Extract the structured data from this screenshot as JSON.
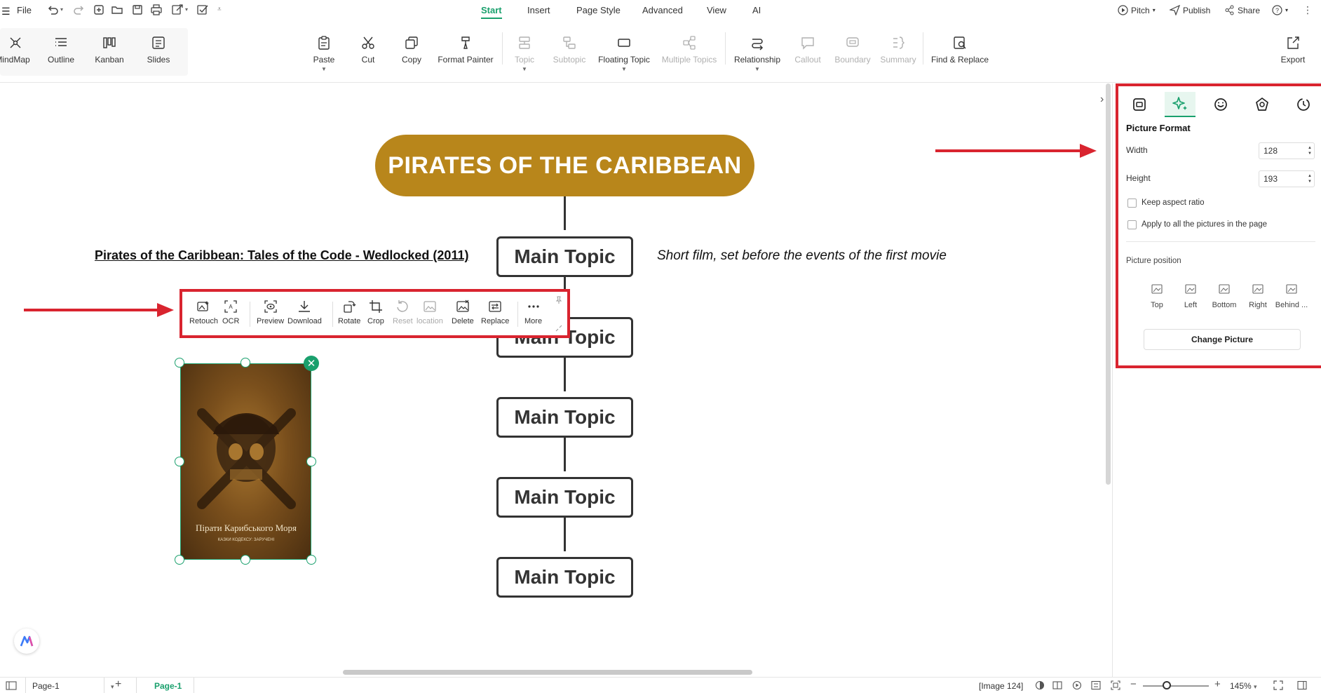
{
  "menubar": {
    "file_label": "File",
    "tabs": [
      {
        "label": "Start",
        "active": true
      },
      {
        "label": "Insert",
        "active": false
      },
      {
        "label": "Page Style",
        "active": false
      },
      {
        "label": "Advanced",
        "active": false
      },
      {
        "label": "View",
        "active": false
      },
      {
        "label": "AI",
        "active": false
      }
    ],
    "pitch_label": "Pitch",
    "publish_label": "Publish",
    "share_label": "Share"
  },
  "ribbon": {
    "views": [
      {
        "label": "MindMap",
        "icon": "mindmap-icon",
        "active": true
      },
      {
        "label": "Outline",
        "icon": "outline-icon"
      },
      {
        "label": "Kanban",
        "icon": "kanban-icon"
      },
      {
        "label": "Slides",
        "icon": "slides-icon"
      }
    ],
    "clipboard": {
      "paste": "Paste",
      "cut": "Cut",
      "copy": "Copy",
      "format_painter": "Format Painter"
    },
    "insert": {
      "topic": "Topic",
      "subtopic": "Subtopic",
      "floating_topic": "Floating Topic",
      "multiple_topics": "Multiple Topics"
    },
    "structure": {
      "relationship": "Relationship",
      "callout": "Callout",
      "boundary": "Boundary",
      "summary": "Summary"
    },
    "find_replace": "Find & Replace",
    "export": "Export"
  },
  "canvas": {
    "central_topic": "PIRATES OF THE CARIBBEAN",
    "main_topics": [
      "Main Topic",
      "Main Topic",
      "Main Topic",
      "Main Topic",
      "Main Topic"
    ],
    "left_note": "Pirates of the Caribbean: Tales of the Code - Wedlocked (2011)",
    "right_note": "Short film, set before the events of the first movie",
    "picture": {
      "poster_title": "Пірати Карибського Моря",
      "poster_subtitle": "КАЗКИ КОДЕКСУ: ЗАРУЧЕНІ"
    }
  },
  "picture_toolbar": {
    "retouch": "Retouch",
    "ocr": "OCR",
    "preview": "Preview",
    "download": "Download",
    "rotate": "Rotate",
    "crop": "Crop",
    "reset": "Reset",
    "location": "location",
    "delete": "Delete",
    "replace": "Replace",
    "more": "More"
  },
  "right_panel": {
    "section_title": "Picture Format",
    "width_label": "Width",
    "width_value": "128",
    "height_label": "Height",
    "height_value": "193",
    "keep_aspect_label": "Keep aspect ratio",
    "keep_aspect_checked": false,
    "apply_all_label": "Apply to all the pictures in the page",
    "apply_all_checked": false,
    "position_label": "Picture position",
    "positions": [
      "Top",
      "Left",
      "Bottom",
      "Right",
      "Behind ..."
    ],
    "change_picture_label": "Change Picture"
  },
  "statusbar": {
    "page_select": "Page-1",
    "page_tab": "Page-1",
    "selection_info": "[Image 124]",
    "zoom": "145%"
  },
  "colors": {
    "accent": "#1aa06d",
    "central_topic_fill": "#b8861b",
    "highlight_red": "#d9242f"
  }
}
